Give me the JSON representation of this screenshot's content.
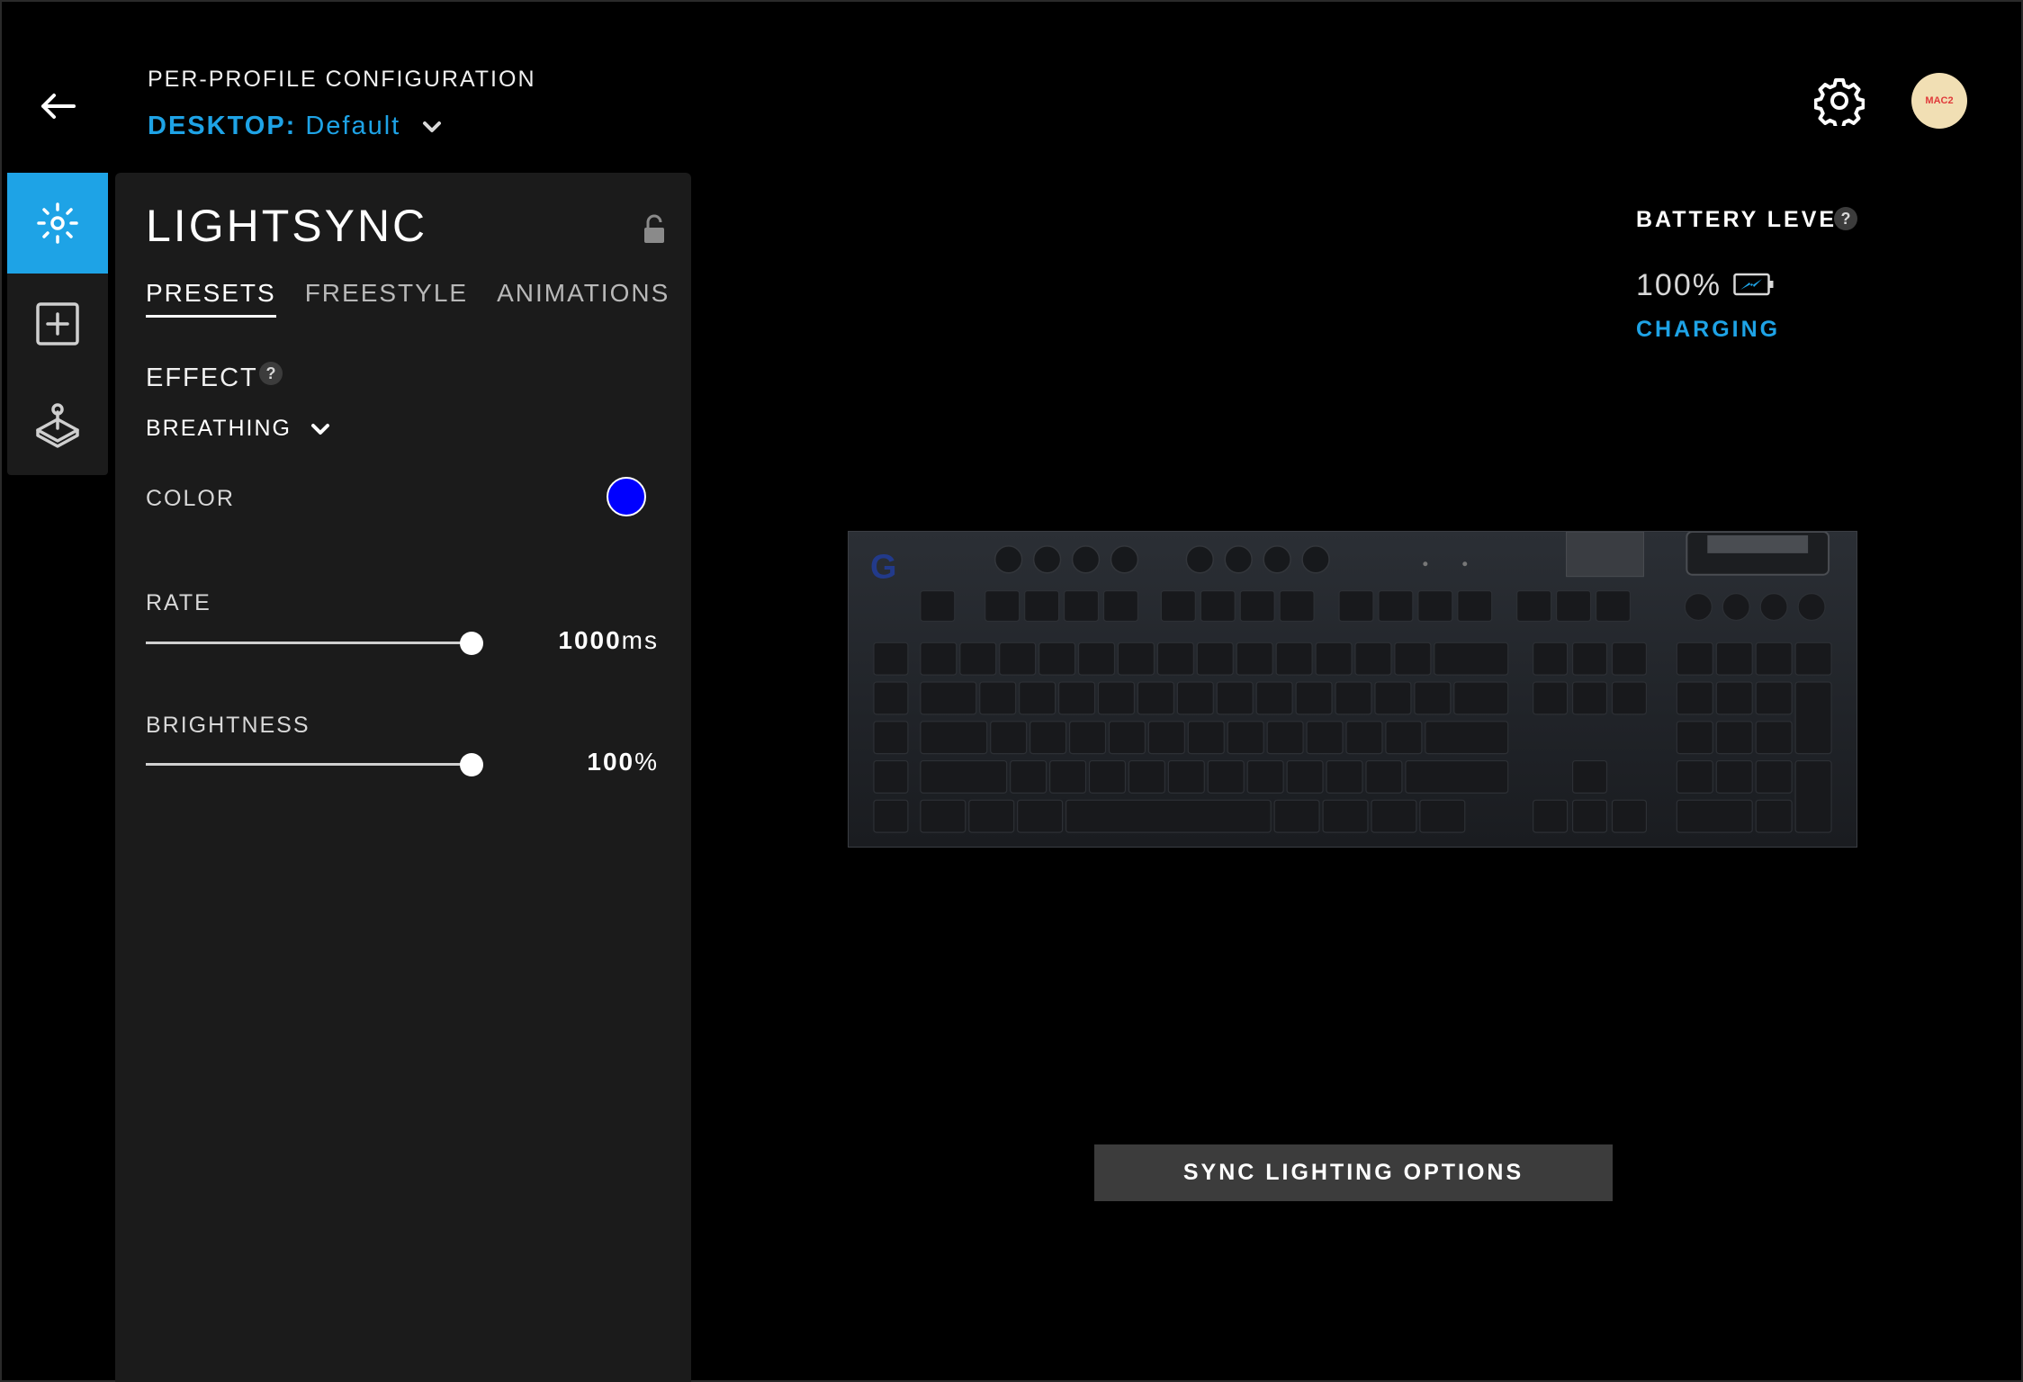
{
  "header": {
    "title": "PER-PROFILE CONFIGURATION",
    "profile_prefix": "DESKTOP:",
    "profile_name": "Default"
  },
  "user": {
    "avatar_text": "MAC2"
  },
  "rail": {
    "items": [
      {
        "icon": "lightsync-icon",
        "active": true
      },
      {
        "icon": "assignments-icon",
        "active": false
      },
      {
        "icon": "game-mode-icon",
        "active": false
      }
    ]
  },
  "panel": {
    "title": "LIGHTSYNC",
    "tabs": [
      {
        "label": "PRESETS",
        "active": true
      },
      {
        "label": "FREESTYLE",
        "active": false
      },
      {
        "label": "ANIMATIONS",
        "active": false
      }
    ],
    "effect_label": "EFFECT",
    "help_glyph": "?",
    "effect_value": "BREATHING",
    "color_label": "COLOR",
    "color_value": "#0000ff",
    "rate_label": "RATE",
    "rate_value": "1000",
    "rate_unit": "ms",
    "rate_level": 1.0,
    "brightness_label": "BRIGHTNESS",
    "brightness_value": "100",
    "brightness_unit": "%",
    "brightness_level": 1.0
  },
  "battery": {
    "title": "BATTERY LEVEL",
    "help_glyph": "?",
    "percent": "100%",
    "status": "CHARGING"
  },
  "sync_button": "SYNC LIGHTING OPTIONS",
  "colors": {
    "accent": "#1ea3e6",
    "panel_bg": "#1b1b1b",
    "button_bg": "#3c3c3c"
  }
}
